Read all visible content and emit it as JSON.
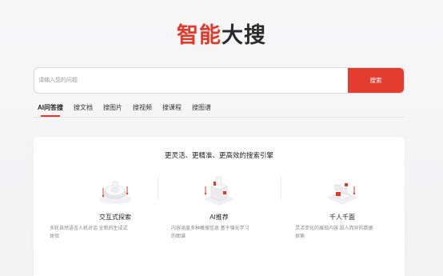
{
  "logo": {
    "part1": "智能",
    "part2": "大搜"
  },
  "search": {
    "placeholder": "请输入您的问题",
    "button_label": "搜索"
  },
  "tabs": [
    {
      "label": "AI问答搜",
      "active": true
    },
    {
      "label": "搜文档",
      "active": false
    },
    {
      "label": "搜图片",
      "active": false
    },
    {
      "label": "搜视频",
      "active": false
    },
    {
      "label": "搜课程",
      "active": false
    },
    {
      "label": "搜图谱",
      "active": false
    }
  ],
  "card": {
    "title": "更灵活、更精准、更高效的搜索引擎",
    "features": [
      {
        "icon": "interaction-icon",
        "name": "交互式探索",
        "desc_line1": "多轮自然语言人机对话 全新的生成式",
        "desc_line2": "体验"
      },
      {
        "icon": "recommend-icon",
        "name": "AI推荐",
        "desc_line1": "内容涵盖多种概搜信息 基于强化学习",
        "desc_line2": "的图谱"
      },
      {
        "icon": "personalize-icon",
        "name": "千人千面",
        "desc_line1": "灵活变化的展现内容 因人而异的数据",
        "desc_line2": "探索"
      }
    ]
  },
  "colors": {
    "accent": "#e23d2e",
    "text": "#222222",
    "muted": "#888888"
  }
}
